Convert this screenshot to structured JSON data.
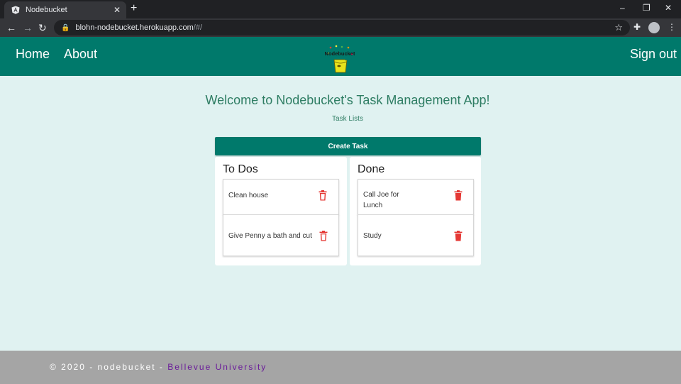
{
  "browser": {
    "tab_title": "Nodebucket",
    "tab_close_glyph": "✕",
    "new_tab_glyph": "+",
    "url_host": "blohn-nodebucket.herokuapp.com",
    "url_path": "/#/",
    "back_glyph": "←",
    "forward_glyph": "→",
    "reload_glyph": "↻",
    "lock_glyph": "🔒",
    "star_glyph": "☆",
    "extensions_glyph": "✚",
    "menu_glyph": "⋮",
    "minimize_glyph": "–",
    "restore_glyph": "❐",
    "close_glyph": "✕"
  },
  "header": {
    "nav": [
      "Home",
      "About"
    ],
    "sign_out": "Sign out",
    "logo_text": "Nodebucket",
    "background": "#00796b"
  },
  "main": {
    "welcome": "Welcome to Nodebucket's Task Management App!",
    "subtitle": "Task Lists",
    "create_button": "Create Task",
    "todo": {
      "title": "To Dos",
      "items": [
        "Clean house",
        "Give Penny a bath and cut"
      ]
    },
    "done": {
      "title": "Done",
      "items": [
        "Call Joe for Lunch",
        "Study"
      ]
    },
    "delete_icon": "trash-icon",
    "delete_color": "#e53935"
  },
  "footer": {
    "text": "© 2020 - nodebucket - ",
    "link": "Bellevue University",
    "link_color": "#6a1b9a"
  }
}
